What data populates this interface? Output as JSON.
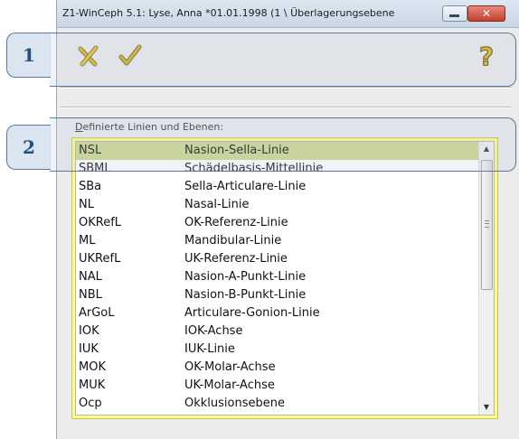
{
  "window": {
    "title": "Z1-WinCeph 5.1: Lyse, Anna *01.01.1998 (1 \\ Überlagerungsebene",
    "close_glyph": "✕"
  },
  "toolbar": {
    "cancel_icon": "x-cancel-icon",
    "confirm_icon": "checkmark-icon",
    "help_icon": "question-mark-icon",
    "colors": {
      "cancel": "#d2b21f",
      "confirm": "#c7a51a",
      "help": "#e0b21c"
    }
  },
  "callouts": [
    {
      "label": "1"
    },
    {
      "label": "2"
    }
  ],
  "list": {
    "label_accel": "D",
    "label_rest": "efinierte Linien und Ebenen:",
    "highlight_color": "#fffb85",
    "selected_color": "#cfd78a",
    "selected_index": 0,
    "scroll_up": "▲",
    "scroll_down": "▼",
    "items": [
      {
        "abbr": "NSL",
        "name": "Nasion-Sella-Linie"
      },
      {
        "abbr": "SBML",
        "name": "Schädelbasis-Mittellinie"
      },
      {
        "abbr": "SBa",
        "name": "Sella-Articulare-Linie"
      },
      {
        "abbr": "NL",
        "name": "Nasal-Linie"
      },
      {
        "abbr": "OKRefL",
        "name": "OK-Referenz-Linie"
      },
      {
        "abbr": "ML",
        "name": "Mandibular-Linie"
      },
      {
        "abbr": "UKRefL",
        "name": "UK-Referenz-Linie"
      },
      {
        "abbr": "NAL",
        "name": "Nasion-A-Punkt-Linie"
      },
      {
        "abbr": "NBL",
        "name": "Nasion-B-Punkt-Linie"
      },
      {
        "abbr": "ArGoL",
        "name": "Articulare-Gonion-Linie"
      },
      {
        "abbr": "IOK",
        "name": "IOK-Achse"
      },
      {
        "abbr": "IUK",
        "name": "IUK-Linie"
      },
      {
        "abbr": "MOK",
        "name": "OK-Molar-Achse"
      },
      {
        "abbr": "MUK",
        "name": "UK-Molar-Achse"
      },
      {
        "abbr": "Ocp",
        "name": "Okklusionsebene"
      }
    ]
  }
}
